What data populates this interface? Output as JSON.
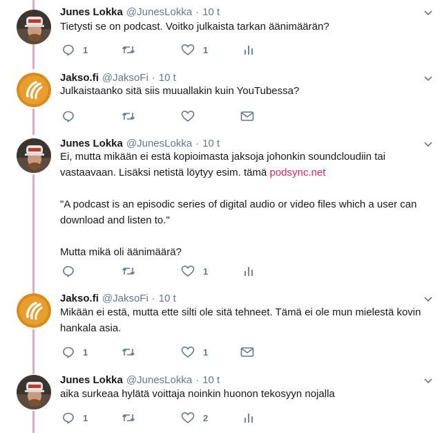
{
  "tweets": [
    {
      "author": "junes",
      "name": "Junes Lokka",
      "handle": "@JunesLokka",
      "sep": "·",
      "time": "10 t",
      "lines": [
        "Tietysti se on podcast. Voitko julkaista tarkan äänimäärän?"
      ],
      "reply_count": "1",
      "retweet_count": "",
      "like_count": "1",
      "last_action": "analytics-icon"
    },
    {
      "author": "jakso",
      "name": "Jakso.fi",
      "handle": "@JaksoFi",
      "sep": "·",
      "time": "10 t",
      "lines": [
        "Julkaistaanko sitä siis muuallakin kuin YouTubessa?"
      ],
      "reply_count": "",
      "retweet_count": "",
      "like_count": "",
      "last_action": "mail-icon"
    },
    {
      "author": "junes",
      "name": "Junes Lokka",
      "handle": "@JunesLokka",
      "sep": "·",
      "time": "10 t",
      "line1": "Ei, mutta mikään ei estä kopioimasta jaksoja johonkin soundcloudiin tai",
      "line2_pre": "vastaavaan. Lisäksi netistä löytyy esim. tämä ",
      "link": "podsync.net",
      "quote1": "\"A podcast is an episodic series of digital audio or video files which a user can",
      "quote2": "download and listen to.\"",
      "line_last": "Mutta mikä oli äänimäärä?",
      "reply_count": "",
      "retweet_count": "",
      "like_count": "1",
      "last_action": "analytics-icon"
    },
    {
      "author": "jakso",
      "name": "Jakso.fi",
      "handle": "@JaksoFi",
      "sep": "·",
      "time": "10 t",
      "lines": [
        "Mikään ei estä, mutta ette silti ole sitä tehneet. Tämä ei ole mun mielestä kovin",
        "hankala asia."
      ],
      "reply_count": "1",
      "retweet_count": "",
      "like_count": "1",
      "last_action": "mail-icon"
    },
    {
      "author": "junes",
      "name": "Junes Lokka",
      "handle": "@JunesLokka",
      "sep": "·",
      "time": "10 t",
      "lines": [
        "aika surkeaa hylätä voittaja noinkin huonon tekosyyn nojalla"
      ],
      "reply_count": "1",
      "retweet_count": "",
      "like_count": "2",
      "last_action": "analytics-icon"
    }
  ],
  "colors": {
    "thread_line": "#ef9fbf",
    "link": "#e0245e",
    "secondary_text": "#657786",
    "jakso_avatar_bg": "#d88a1c"
  }
}
